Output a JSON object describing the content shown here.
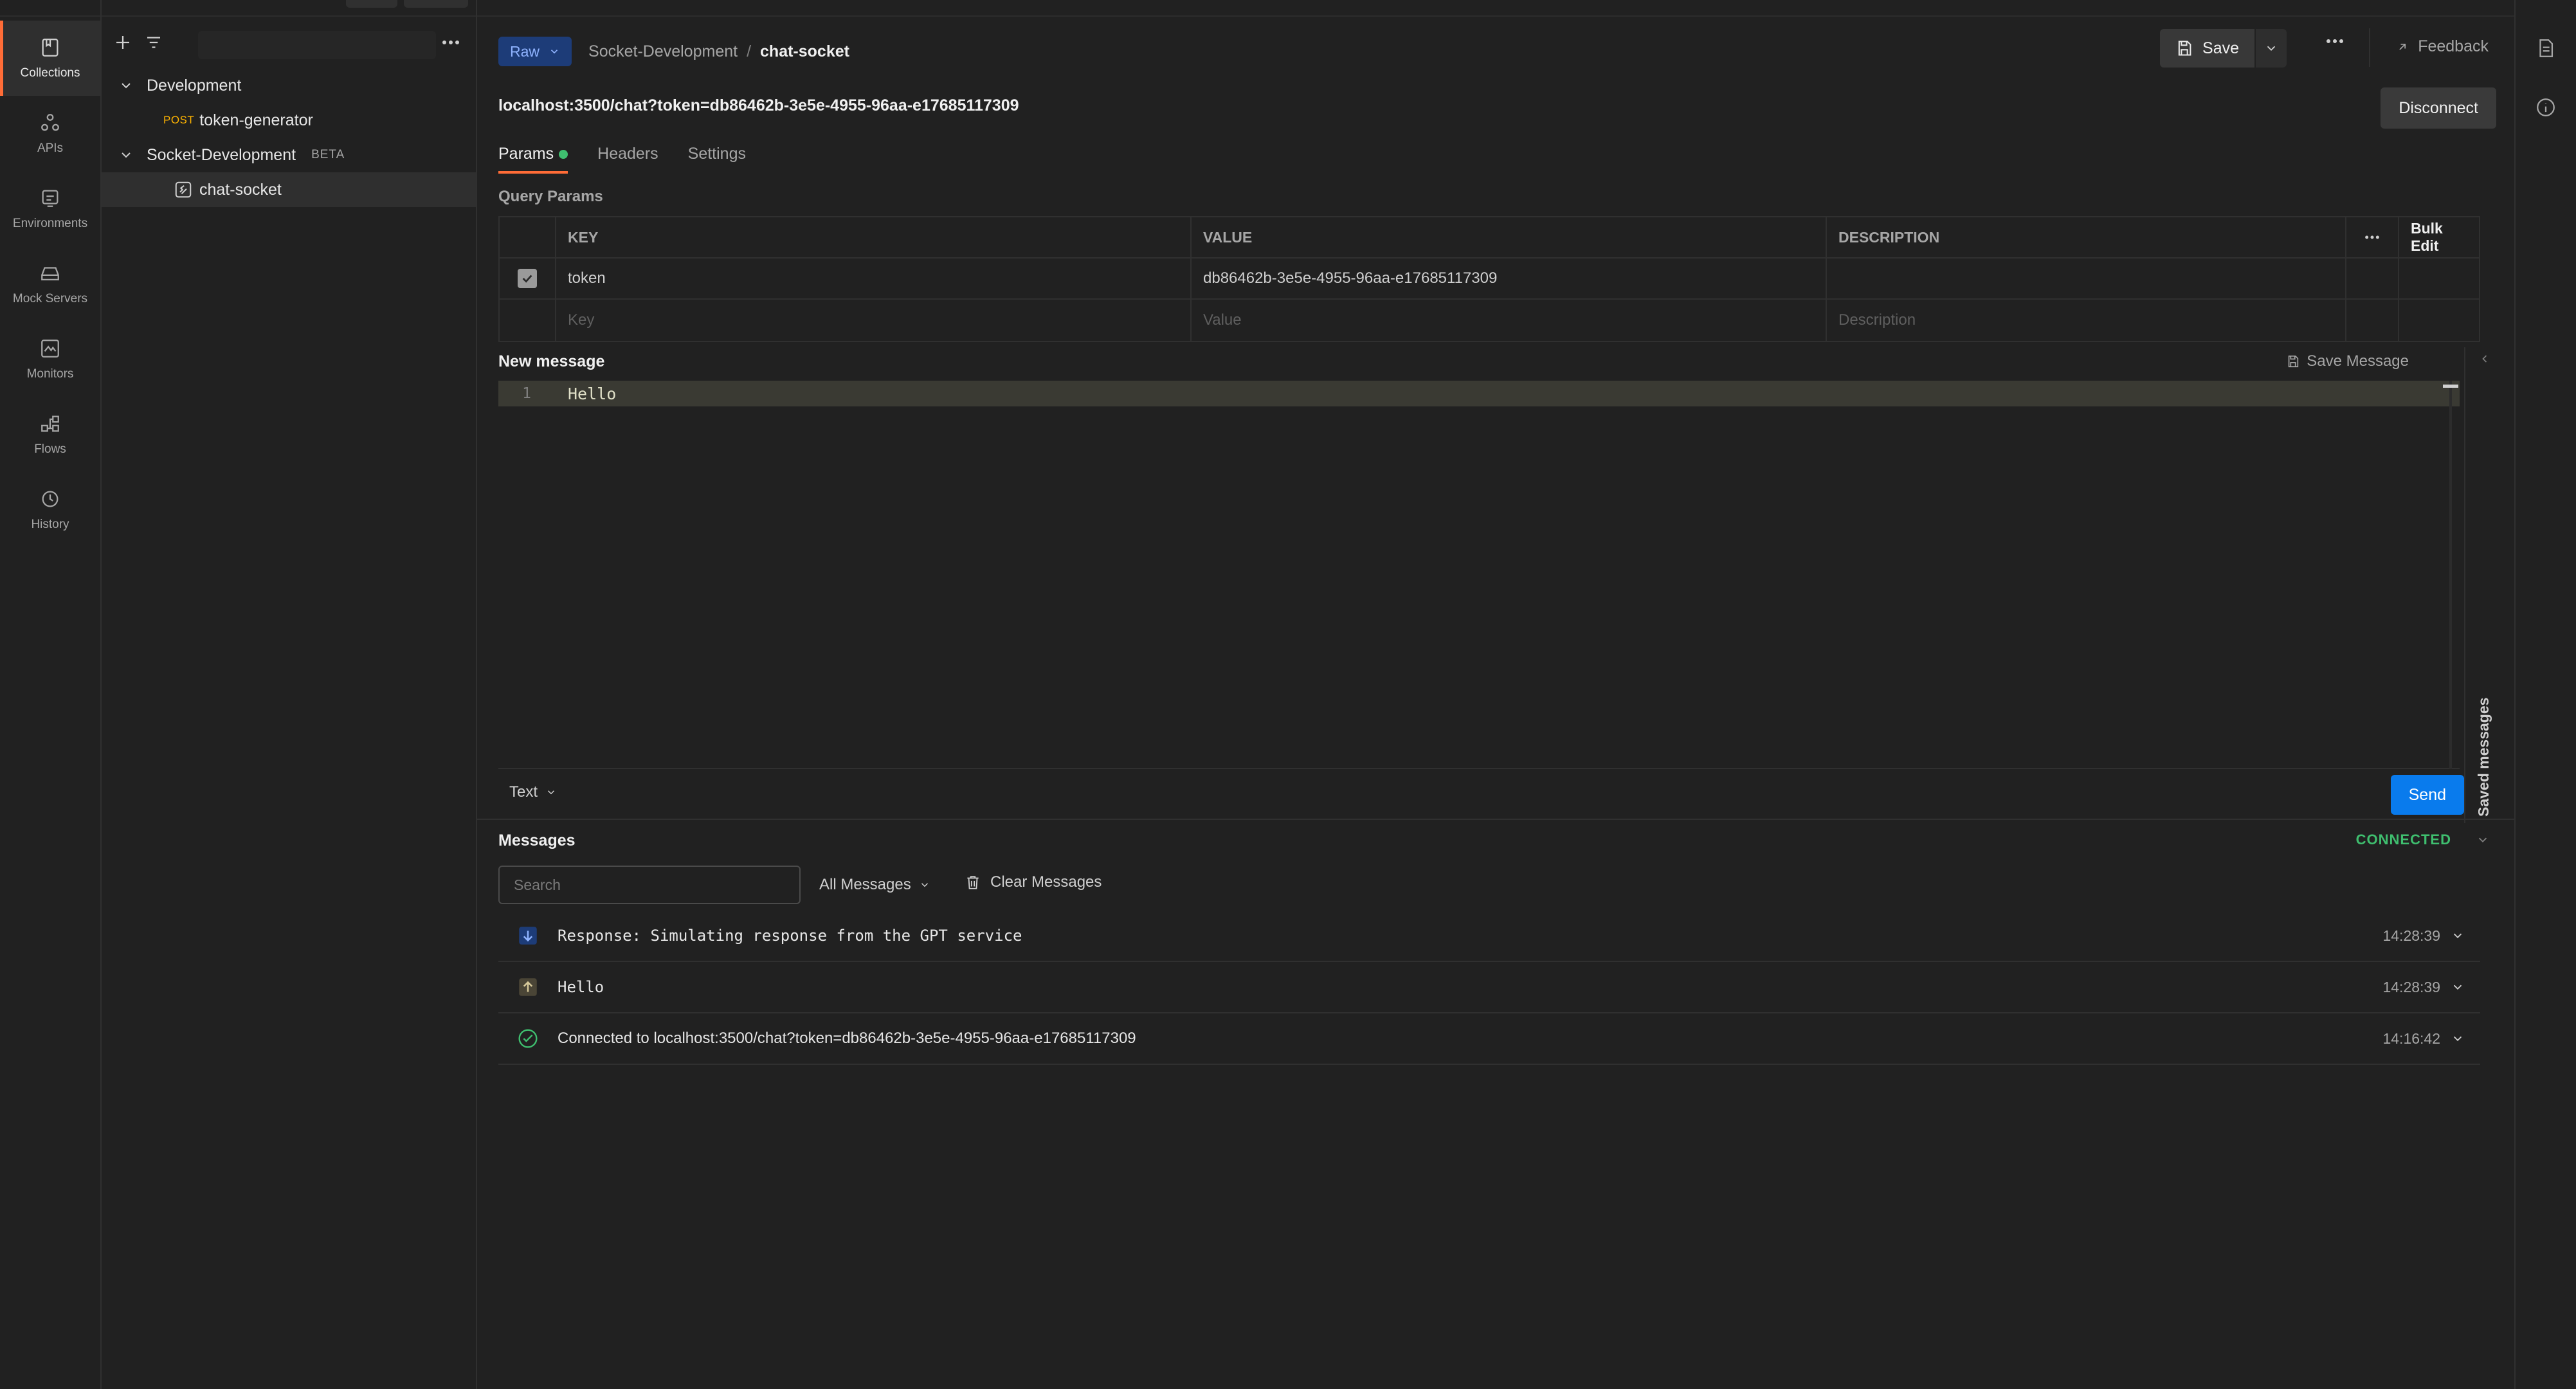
{
  "rail": {
    "items": [
      {
        "label": "Collections",
        "icon": "collections-icon",
        "active": true
      },
      {
        "label": "APIs",
        "icon": "apis-icon"
      },
      {
        "label": "Environments",
        "icon": "environments-icon"
      },
      {
        "label": "Mock Servers",
        "icon": "mock-servers-icon"
      },
      {
        "label": "Monitors",
        "icon": "monitors-icon"
      },
      {
        "label": "Flows",
        "icon": "flows-icon"
      },
      {
        "label": "History",
        "icon": "history-icon"
      }
    ]
  },
  "sidebar": {
    "tree": {
      "development": {
        "label": "Development"
      },
      "token_generator": {
        "method": "POST",
        "label": "token-generator"
      },
      "socket_development": {
        "label": "Socket-Development",
        "badge": "BETA"
      },
      "chat_socket": {
        "label": "chat-socket"
      }
    }
  },
  "request": {
    "mode_label": "Raw",
    "breadcrumb": {
      "parent": "Socket-Development",
      "separator": "/",
      "current": "chat-socket"
    },
    "save_label": "Save",
    "feedback_label": "Feedback",
    "url": "localhost:3500/chat?token=db86462b-3e5e-4955-96aa-e17685117309",
    "disconnect_label": "Disconnect",
    "tabs": {
      "params": "Params",
      "headers": "Headers",
      "settings": "Settings"
    },
    "query_params_title": "Query Params",
    "table": {
      "headers": {
        "key": "KEY",
        "value": "VALUE",
        "description": "DESCRIPTION",
        "bulk_edit": "Bulk Edit"
      },
      "rows": [
        {
          "checked": true,
          "key": "token",
          "value": "db86462b-3e5e-4955-96aa-e17685117309",
          "description": ""
        }
      ],
      "placeholders": {
        "key": "Key",
        "value": "Value",
        "description": "Description"
      }
    }
  },
  "composer": {
    "title": "New message",
    "save_message_label": "Save Message",
    "lines": [
      {
        "number": "1",
        "text": "Hello"
      }
    ],
    "format_label": "Text",
    "send_label": "Send",
    "saved_messages_label": "Saved messages"
  },
  "messages": {
    "title": "Messages",
    "status": "CONNECTED",
    "search_placeholder": "Search",
    "filter_label": "All Messages",
    "clear_label": "Clear Messages",
    "items": [
      {
        "direction": "incoming",
        "text": "Response: Simulating response from the GPT service",
        "time": "14:28:39"
      },
      {
        "direction": "outgoing",
        "text": "Hello",
        "time": "14:28:39"
      },
      {
        "direction": "connected",
        "text": "Connected to localhost:3500/chat?token=db86462b-3e5e-4955-96aa-e17685117309",
        "time": "14:16:42"
      }
    ]
  },
  "colors": {
    "accent": "#ff6c37",
    "send": "#097bed",
    "connected": "#3fbf6f",
    "method_post": "#ffb400"
  }
}
